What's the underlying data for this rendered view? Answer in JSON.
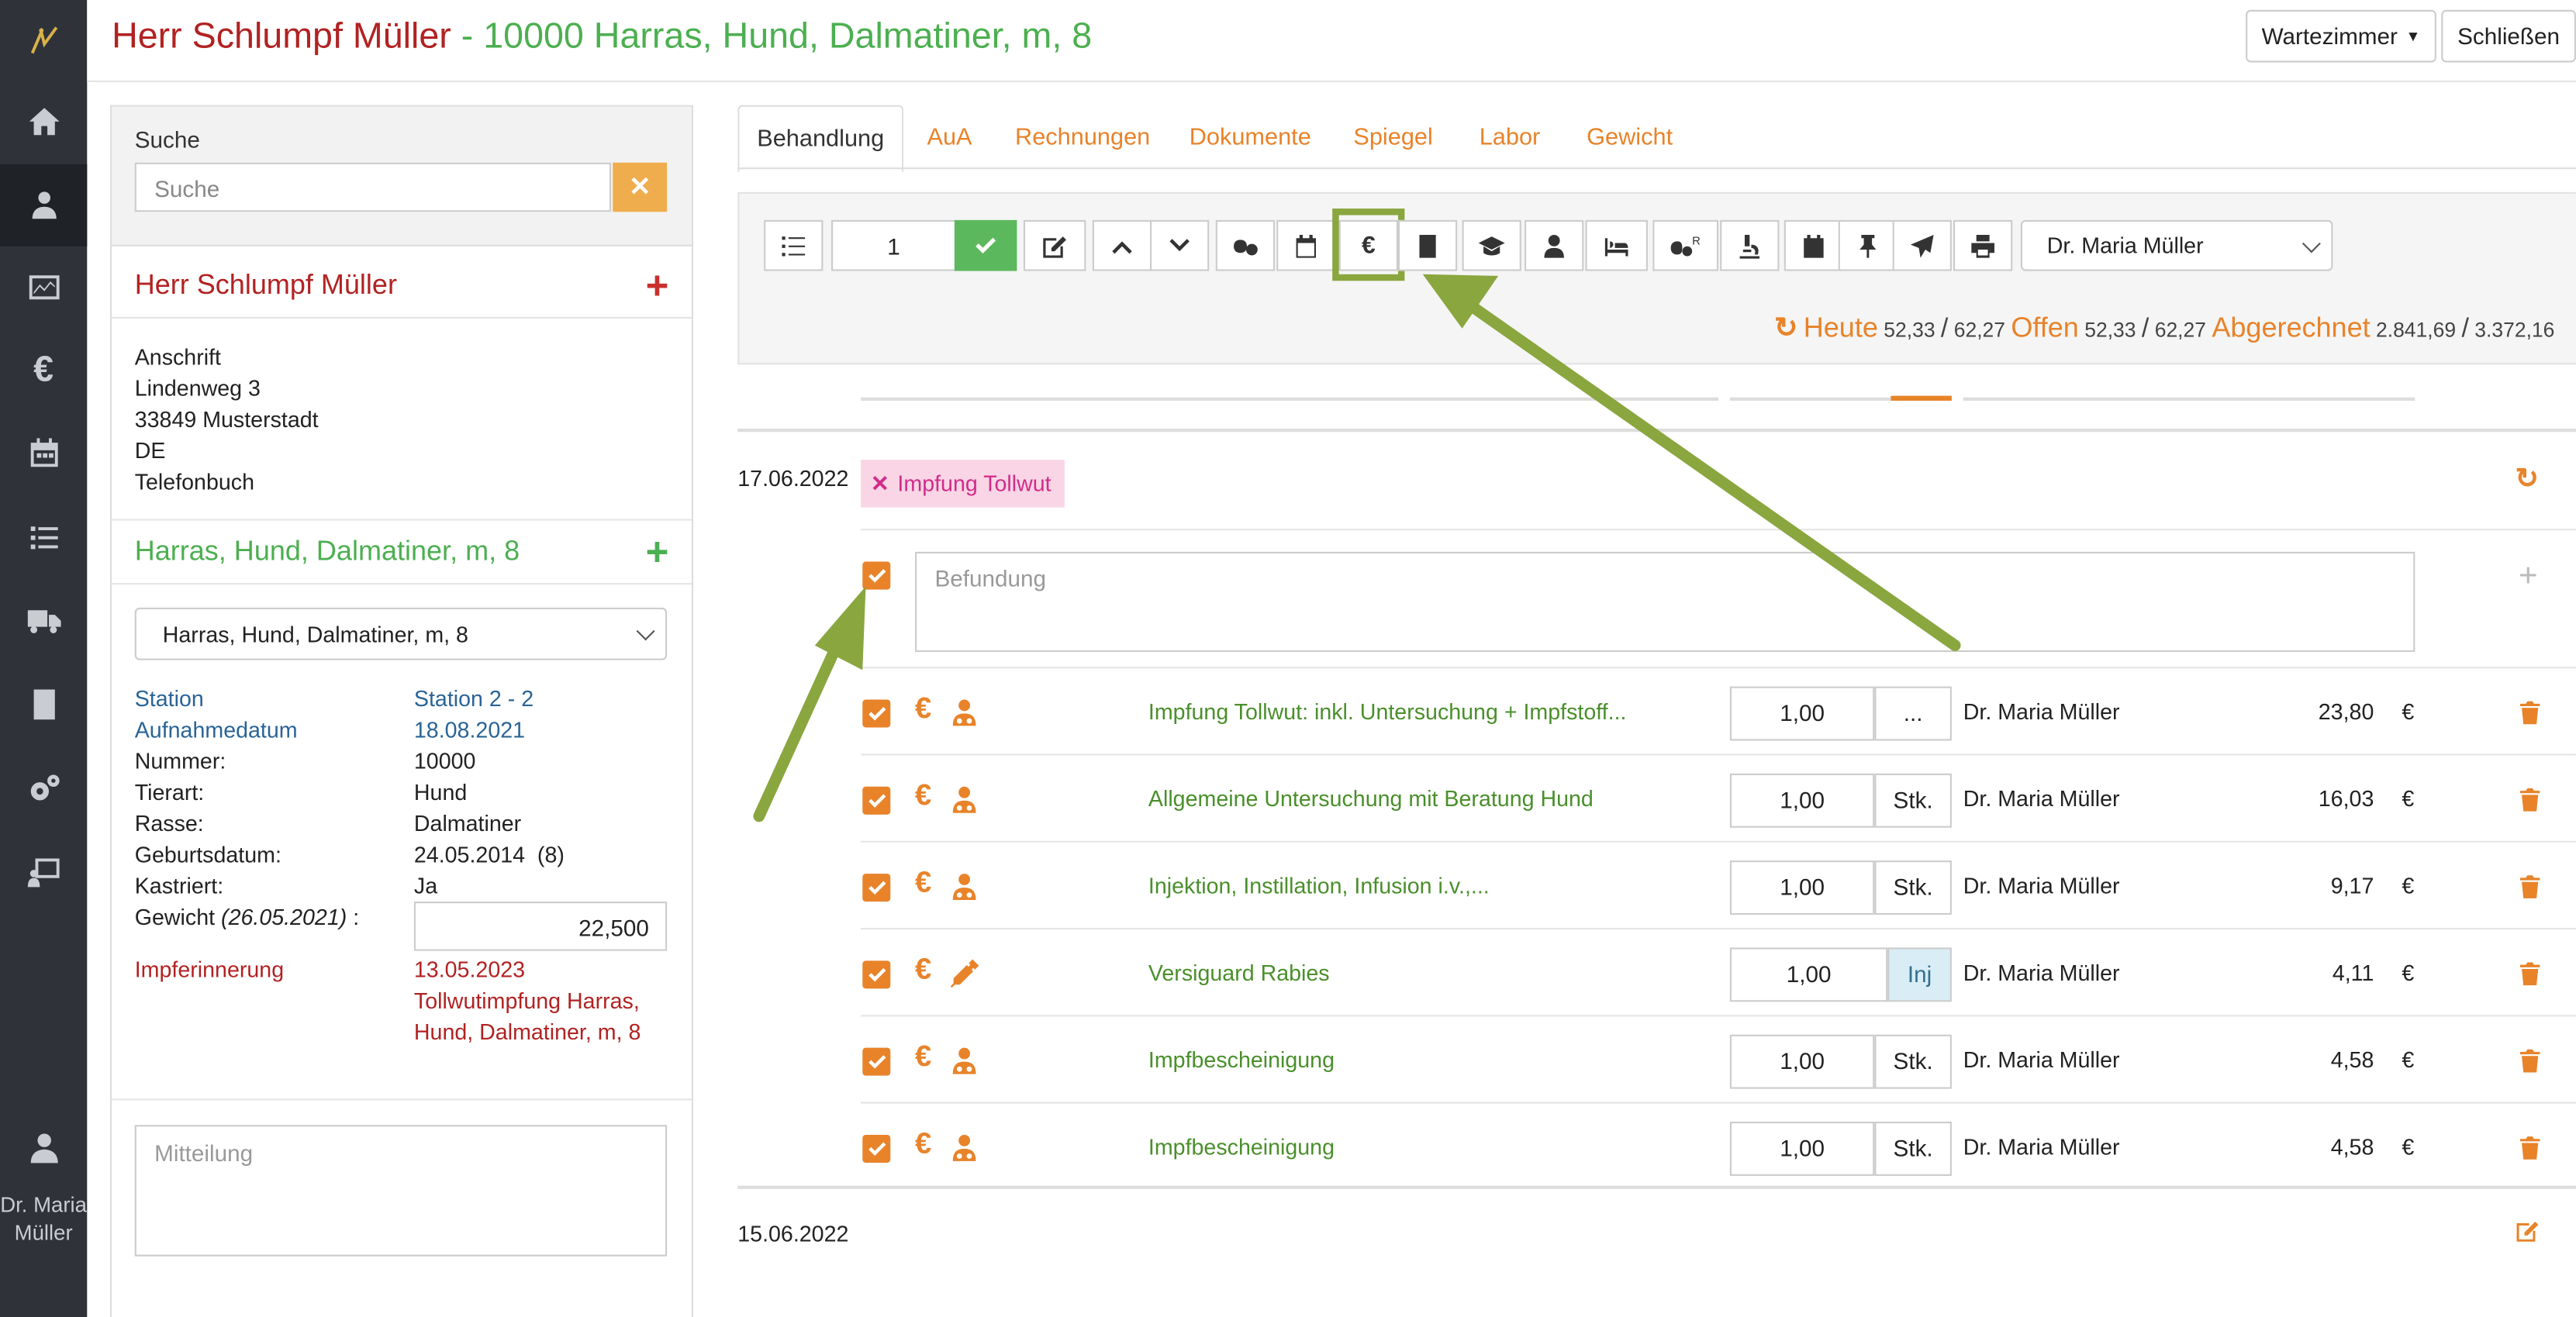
{
  "header": {
    "owner_name": "Herr Schlumpf Müller",
    "animal_summary": "- 10000 Harras, Hund, Dalmatiner, m, 8",
    "waiting_room_label": "Wartezimmer",
    "close_label": "Schließen"
  },
  "nav": {
    "user_name": "Dr. Maria Müller",
    "items": [
      "home-icon",
      "animal-owner-icon",
      "chart-icon",
      "euro-icon",
      "calendar-icon",
      "tasks-icon",
      "truck-icon",
      "book-icon",
      "settings-icon",
      "presentation-icon"
    ]
  },
  "sidebar": {
    "search_label": "Suche",
    "search_placeholder": "Suche",
    "owner_title": "Herr Schlumpf Müller",
    "address_label": "Anschrift",
    "street": "Lindenweg 3",
    "city": "33849  Musterstadt",
    "country": "DE",
    "phonebook": "Telefonbuch",
    "animal_title": "Harras, Hund, Dalmatiner, m, 8",
    "animal_select_value": "Harras, Hund, Dalmatiner, m, 8",
    "station_label": "Station",
    "station_value": "Station 2 - 2",
    "admission_label": "Aufnahmedatum",
    "admission_value": "18.08.2021",
    "number_label": "Nummer:",
    "number_value": "10000",
    "species_label": "Tierart:",
    "species_value": "Hund",
    "breed_label": "Rasse:",
    "breed_value": "Dalmatiner",
    "birth_label": "Geburtsdatum:",
    "birth_value": "24.05.2014  (8)",
    "neutered_label": "Kastriert:",
    "neutered_value": "Ja",
    "weight_label_prefix": "Gewicht",
    "weight_date": "(26.05.2021)",
    "weight_label_suffix": ":",
    "weight_value": "22,500",
    "vaccination_reminder_label": "Impferinnerung",
    "vaccination_reminder_date": "13.05.2023",
    "vaccination_reminder_line1": "Tollwutimpfung Harras,",
    "vaccination_reminder_line2": "Hund, Dalmatiner, m, 8",
    "message_placeholder": "Mitteilung"
  },
  "tabs": [
    "Behandlung",
    "AuA",
    "Rechnungen",
    "Dokumente",
    "Spiegel",
    "Labor",
    "Gewicht"
  ],
  "toolbar": {
    "count_value": "1",
    "doctor_select_value": "Dr. Maria Müller",
    "today_label": "Heute",
    "today_value": "52,33",
    "today_total": "62,27",
    "open_label": "Offen",
    "open_value": "52,33",
    "open_total": "62,27",
    "billed_label": "Abgerechnet",
    "billed_value": "2.841,69",
    "billed_total": "3.372,16",
    "separator": "/"
  },
  "treatment": {
    "date": "17.06.2022",
    "tag_label": "Impfung Tollwut",
    "befund_placeholder": "Befundung",
    "next_date": "15.06.2022",
    "rows": [
      {
        "name": "Impfung Tollwut: inkl. Untersuchung + Impfstoff...",
        "qty": "1,00",
        "unit": "...",
        "doctor": "Dr. Maria Müller",
        "price": "23,80",
        "currency": "€",
        "icon": "doctor-icon"
      },
      {
        "name": "Allgemeine Untersuchung mit Beratung Hund",
        "qty": "1,00",
        "unit": "Stk.",
        "doctor": "Dr. Maria Müller",
        "price": "16,03",
        "currency": "€",
        "icon": "doctor-icon"
      },
      {
        "name": "Injektion, Instillation, Infusion i.v.,...",
        "qty": "1,00",
        "unit": "Stk.",
        "doctor": "Dr. Maria Müller",
        "price": "9,17",
        "currency": "€",
        "icon": "doctor-icon"
      },
      {
        "name": "Versiguard Rabies",
        "qty": "1,00",
        "unit": "Inj",
        "doctor": "Dr. Maria Müller",
        "price": "4,11",
        "currency": "€",
        "icon": "syringe-icon"
      },
      {
        "name": "Impfbescheinigung",
        "qty": "1,00",
        "unit": "Stk.",
        "doctor": "Dr. Maria Müller",
        "price": "4,58",
        "currency": "€",
        "icon": "doctor-icon"
      },
      {
        "name": "Impfbescheinigung",
        "qty": "1,00",
        "unit": "Stk.",
        "doctor": "Dr. Maria Müller",
        "price": "4,58",
        "currency": "€",
        "icon": "doctor-icon"
      }
    ]
  },
  "colors": {
    "accent_orange": "#e8832a",
    "owner_red": "#b22222",
    "animal_green": "#4caf50",
    "item_green": "#4a8f2b",
    "annotation_green": "#8aa63f",
    "nav_dark": "#2f3339"
  }
}
